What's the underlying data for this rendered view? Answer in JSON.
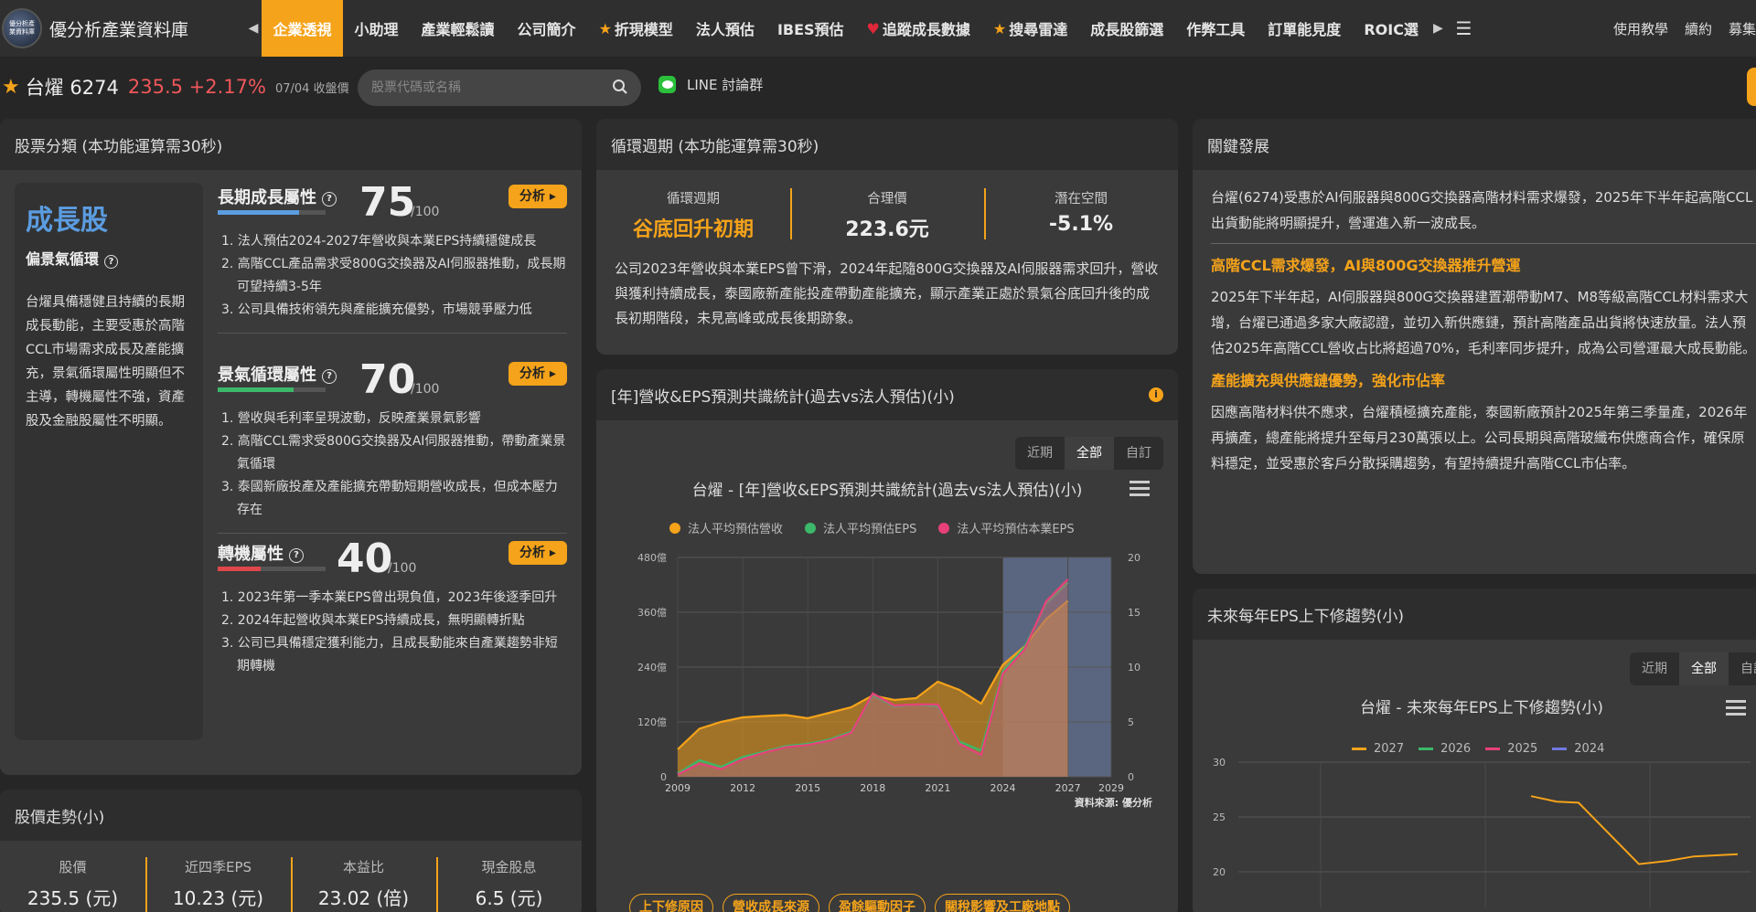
{
  "nav": {
    "logo_text": "優分析產業資料庫",
    "logo_mark": "優分析產業資料庫",
    "items": [
      "企業透視",
      "小助理",
      "產業輕鬆讀",
      "公司簡介",
      "折現模型",
      "法人預估",
      "IBES預估",
      "追蹤成長數據",
      "搜尋雷達",
      "成長股篩選",
      "作弊工具",
      "訂單能見度",
      "ROIC選"
    ],
    "active_index": 0,
    "right": [
      "使用教學",
      "續約",
      "募集"
    ]
  },
  "ticker": {
    "name": "台燿 6274",
    "price": "235.5 +2.17%",
    "date": "07/04 收盤價",
    "search_placeholder": "股票代碼或名稱",
    "line": "LINE 討論群"
  },
  "classify": {
    "title": "股票分類 (本功能運算需30秒)",
    "type": "成長股",
    "lean": "偏景氣循環",
    "desc": "台燿具備穩健且持續的長期成長動能，主要受惠於高階CCL市場需求成長及產能擴充，景氣循環屬性明顯但不主導，轉機屬性不強，資產股及金融股屬性不明顯。",
    "max_label": "/100",
    "btn_label": "分析",
    "attrs": [
      {
        "name": "長期成長屬性",
        "score": "75",
        "value": 75,
        "color": "#5b9ce0",
        "points": [
          "1. 法人預估2024-2027年營收與本業EPS持續穩健成長",
          "2. 高階CCL產品需求受800G交換器及AI伺服器推動，成長期可望持續3-5年",
          "3. 公司具備技術領先與產能擴充優勢，市場競爭壓力低"
        ]
      },
      {
        "name": "景氣循環屬性",
        "score": "70",
        "value": 70,
        "color": "#3cb86a",
        "points": [
          "1. 營收與毛利率呈現波動，反映產業景氣影響",
          "2. 高階CCL需求受800G交換器及AI伺服器推動，帶動產業景氣循環",
          "3. 泰國新廠投產及產能擴充帶動短期營收成長，但成本壓力存在"
        ]
      },
      {
        "name": "轉機屬性",
        "score": "40",
        "value": 40,
        "color": "#e0474a",
        "points": [
          "1. 2023年第一季本業EPS曾出現負值，2023年後逐季回升",
          "2. 2024年起營收與本業EPS持續成長，無明顯轉折點",
          "3. 公司已具備穩定獲利能力，且成長動能來自產業趨勢非短期轉機"
        ]
      }
    ]
  },
  "price_trend": {
    "title": "股價走勢(小)",
    "stats": [
      {
        "label": "股價",
        "value": "235.5 (元)"
      },
      {
        "label": "近四季EPS",
        "value": "10.23 (元)"
      },
      {
        "label": "本益比",
        "value": "23.02 (倍)"
      },
      {
        "label": "現金股息",
        "value": "6.5 (元)"
      }
    ]
  },
  "cycle": {
    "title": "循環週期 (本功能運算需30秒)",
    "items": [
      {
        "label": "循環週期",
        "value": "谷底回升初期"
      },
      {
        "label": "合理價",
        "value": "223.6元"
      },
      {
        "label": "潛在空間",
        "value": "-5.1%"
      }
    ],
    "text": "公司2023年營收與本業EPS曾下滑，2024年起隨800G交換器及AI伺服器需求回升，營收與獲利持續成長，泰國廠新產能投產帶動產能擴充，顯示產業正處於景氣谷底回升後的成長初期階段，未見高峰或成長後期跡象。"
  },
  "consensus": {
    "title": "[年]營收&EPS預測共識統計(過去vs法人預估)(小)",
    "tabs": [
      "近期",
      "全部",
      "自訂"
    ],
    "active_tab": 1,
    "chart_title": "台燿 - [年]營收&EPS預測共識統計(過去vs法人預估)(小)",
    "source": "資料來源: 優分析",
    "pills": [
      "上下修原因",
      "營收成長來源",
      "盈餘驅動因子",
      "關稅影響及工廠地點"
    ]
  },
  "key_dev": {
    "title": "關鍵發展",
    "intro": "台燿(6274)受惠於AI伺服器與800G交換器高階材料需求爆發，2025年下半年起高階CCL出貨動能將明顯提升，營運進入新一波成長。",
    "sections": [
      {
        "heading": "高階CCL需求爆發，AI與800G交換器推升營運",
        "text": "2025年下半年起，AI伺服器與800G交換器建置潮帶動M7、M8等級高階CCL材料需求大增，台燿已通過多家大廠認證，並切入新供應鏈，預計高階產品出貨將快速放量。法人預估2025年高階CCL營收占比將超過70%，毛利率同步提升，成為公司營運最大成長動能。"
      },
      {
        "heading": "產能擴充與供應鏈優勢，強化市佔率",
        "text": "因應高階材料供不應求，台燿積極擴充產能，泰國新廠預計2025年第三季量產，2026年再擴產，總產能將提升至每月230萬張以上。公司長期與高階玻纖布供應商合作，確保原料穩定，並受惠於客戶分散採購趨勢，有望持續提升高階CCL市佔率。"
      }
    ]
  },
  "eps_trend": {
    "title": "未來每年EPS上下修趨勢(小)",
    "tabs": [
      "近期",
      "全部",
      "自訂"
    ],
    "active_tab": 1,
    "chart_title": "台燿 - 未來每年EPS上下修趨勢(小)"
  },
  "colors": {
    "accent": "#f5a31a",
    "blue": "#5b9ce0",
    "green": "#3cb86a",
    "red": "#e0474a",
    "pink": "#e8407a"
  },
  "chart_data": [
    {
      "type": "area",
      "title": "台燿 - [年]營收&EPS預測共識統計(過去vs法人預估)(小)",
      "x": [
        2009,
        2010,
        2011,
        2012,
        2013,
        2014,
        2015,
        2016,
        2017,
        2018,
        2019,
        2020,
        2021,
        2022,
        2023,
        2024,
        2025,
        2026,
        2027
      ],
      "x_ticks": [
        2009,
        2012,
        2015,
        2018,
        2021,
        2024,
        2027,
        2029
      ],
      "y_left": {
        "label": "",
        "ticks": [
          "0",
          "120億",
          "240億",
          "360億",
          "480億"
        ],
        "ylim": [
          0,
          480
        ]
      },
      "y_right": {
        "label": "",
        "ticks": [
          0,
          5,
          10,
          15,
          20
        ],
        "ylim": [
          0,
          20
        ]
      },
      "series": [
        {
          "name": "法人平均預估營收",
          "axis": "left",
          "color": "#f5a31a",
          "values": [
            60,
            105,
            120,
            130,
            133,
            135,
            128,
            140,
            152,
            178,
            168,
            172,
            208,
            190,
            160,
            245,
            285,
            345,
            385
          ]
        },
        {
          "name": "法人平均預估EPS",
          "axis": "right",
          "color": "#3cb86a",
          "values": [
            0.3,
            1.5,
            0.9,
            1.8,
            2.3,
            2.8,
            3.0,
            3.4,
            4.1,
            7.4,
            6.4,
            6.6,
            6.4,
            3.2,
            2.4,
            9.6,
            11.8,
            15.8,
            17.7
          ]
        },
        {
          "name": "法人平均預估本業EPS",
          "axis": "right",
          "color": "#e8407a",
          "values": [
            0.2,
            1.2,
            0.7,
            1.6,
            2.2,
            2.7,
            2.9,
            3.3,
            4.0,
            7.6,
            6.5,
            6.6,
            6.6,
            3.0,
            2.0,
            9.4,
            11.6,
            16.0,
            18.0
          ]
        }
      ],
      "forecast_band": [
        2024,
        2029
      ]
    },
    {
      "type": "line",
      "title": "台燿 - 未來每年EPS上下修趨勢(小)",
      "ylim": [
        20,
        30
      ],
      "y_ticks": [
        30,
        25,
        20
      ],
      "series": [
        {
          "name": "2027",
          "color": "#f5a31a",
          "values": [
            26.9,
            26.4,
            26.3,
            20.7,
            21.0,
            21.4,
            21.6
          ]
        },
        {
          "name": "2026",
          "color": "#3cb86a",
          "values": []
        },
        {
          "name": "2025",
          "color": "#e8407a",
          "values": []
        },
        {
          "name": "2024",
          "color": "#6f78e0",
          "values": []
        }
      ]
    }
  ]
}
